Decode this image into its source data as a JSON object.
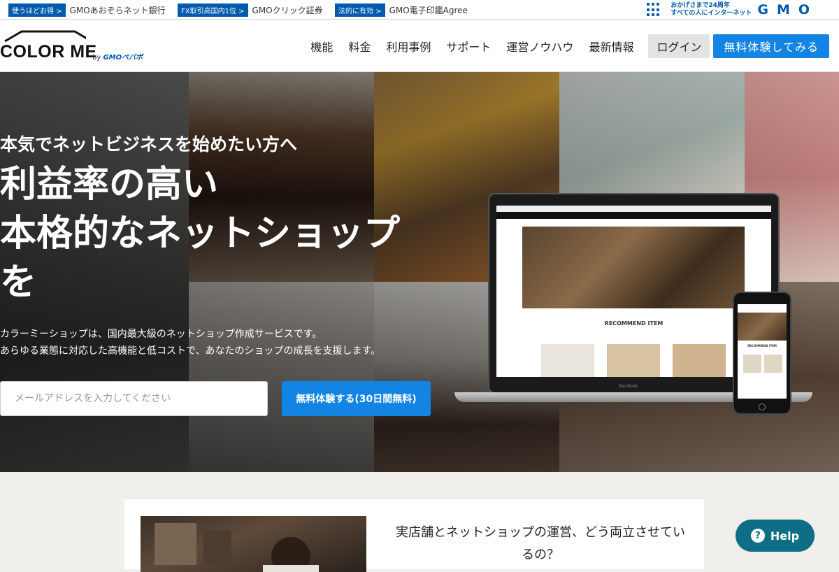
{
  "gmo_bar": {
    "promos": [
      {
        "tag": "使うほどお得",
        "text": "GMOあおぞらネット銀行"
      },
      {
        "tag": "FX取引高国内1位",
        "text": "GMOクリック証券"
      },
      {
        "tag": "法的に有効",
        "text": "GMO電子印鑑Agree"
      }
    ],
    "slogan_line1": "おかげさまで24周年",
    "slogan_line2": "すべての人にインターネット",
    "brand": "GMO"
  },
  "header": {
    "logo_text": "COLOR ME",
    "logo_by": "by",
    "logo_company": "GMOペパボ",
    "nav": [
      "機能",
      "料金",
      "利用事例",
      "サポート",
      "運営ノウハウ",
      "最新情報"
    ],
    "login": "ログイン",
    "trial": "無料体験してみる"
  },
  "hero": {
    "sub": "本気でネットビジネスを始めたい方へ",
    "title_lines": [
      "利益率の高い",
      "本格的なネットショップ",
      "を"
    ],
    "desc_lines": [
      "カラーミーショップは、国内最大級のネットショップ作成サービスです。",
      "あらゆる業態に対応した高機能と低コストで、あなたのショップの成長を支援します。"
    ],
    "email_placeholder": "メールアドレスを入力してください",
    "cta": "無料体験する(30日間無料)"
  },
  "devices": {
    "laptop_heading": "RECOMMEND ITEM",
    "laptop_brand": "MacBook",
    "phone_heading": "RECOMMEND ITEM"
  },
  "feature": {
    "text": "実店舗とネットショップの運営、どう両立させているの？"
  },
  "help": {
    "label": "Help",
    "icon": "?"
  }
}
